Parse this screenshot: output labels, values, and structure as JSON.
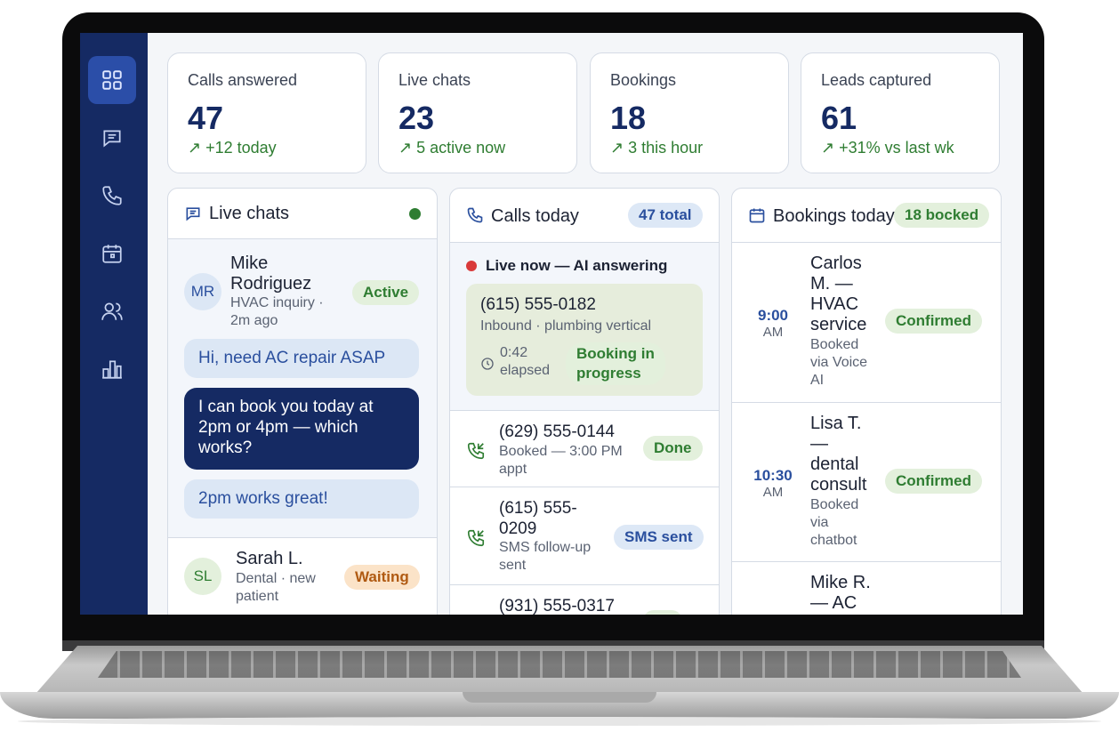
{
  "sidebar": {
    "items": [
      {
        "icon": "dashboard-icon",
        "active": true
      },
      {
        "icon": "chat-icon"
      },
      {
        "icon": "phone-icon"
      },
      {
        "icon": "calendar-icon"
      },
      {
        "icon": "users-icon"
      },
      {
        "icon": "analytics-icon"
      }
    ]
  },
  "stats": [
    {
      "label": "Calls answered",
      "value": "47",
      "trend": "+12 today"
    },
    {
      "label": "Live chats",
      "value": "23",
      "trend": "5 active now"
    },
    {
      "label": "Bookings",
      "value": "18",
      "trend": "3 this hour"
    },
    {
      "label": "Leads captured",
      "value": "61",
      "trend": "+31% vs last wk"
    }
  ],
  "chats": {
    "title": "Live chats",
    "contacts": [
      {
        "initials": "MR",
        "name": "Mike Rodriguez",
        "detail": "HVAC inquiry · 2m ago",
        "status": "Active"
      },
      {
        "initials": "SL",
        "name": "Sarah L.",
        "detail": "Dental · new patient",
        "status": "Waiting"
      }
    ],
    "messages": [
      {
        "from": "customer",
        "text": "Hi, need AC repair ASAP"
      },
      {
        "from": "agent",
        "text": "I can book you today at 2pm or 4pm — which works?"
      },
      {
        "from": "customer",
        "text": "2pm works great!"
      }
    ]
  },
  "calls": {
    "title": "Calls today",
    "badge": "47 total",
    "live_label": "Live now — AI answering",
    "live_call": {
      "number": "(615) 555-0182",
      "detail": "Inbound · plumbing vertical",
      "elapsed": "0:42 elapsed",
      "status": "Booking in progress"
    },
    "list": [
      {
        "number": "(629) 555-0144",
        "detail": "Booked — 3:00 PM appt",
        "status": "Done"
      },
      {
        "number": "(615) 555-0209",
        "detail": "SMS follow-up sent",
        "status": "SMS sent"
      },
      {
        "number": "(931) 555-0317",
        "detail": "",
        "status": ""
      }
    ]
  },
  "bookings": {
    "title": "Bookings today",
    "badge": "18 bocked",
    "list": [
      {
        "time": "9:00",
        "ampm": "AM",
        "title": "Carlos M. — HVAC service",
        "detail": "Booked via Voice AI",
        "status": "Confirmed"
      },
      {
        "time": "10:30",
        "ampm": "AM",
        "title": "Lisa T. — dental consult",
        "detail": "Booked via chatbot",
        "status": "Confirmed"
      },
      {
        "time": "",
        "ampm": "",
        "title": "Mike R. — AC",
        "detail": "",
        "status": ""
      }
    ]
  },
  "colors": {
    "sidebar": "#152a63",
    "accent": "#2a4f9e",
    "success": "#2f7d32",
    "live": "#d93a3a",
    "online": "#2e7d32"
  }
}
